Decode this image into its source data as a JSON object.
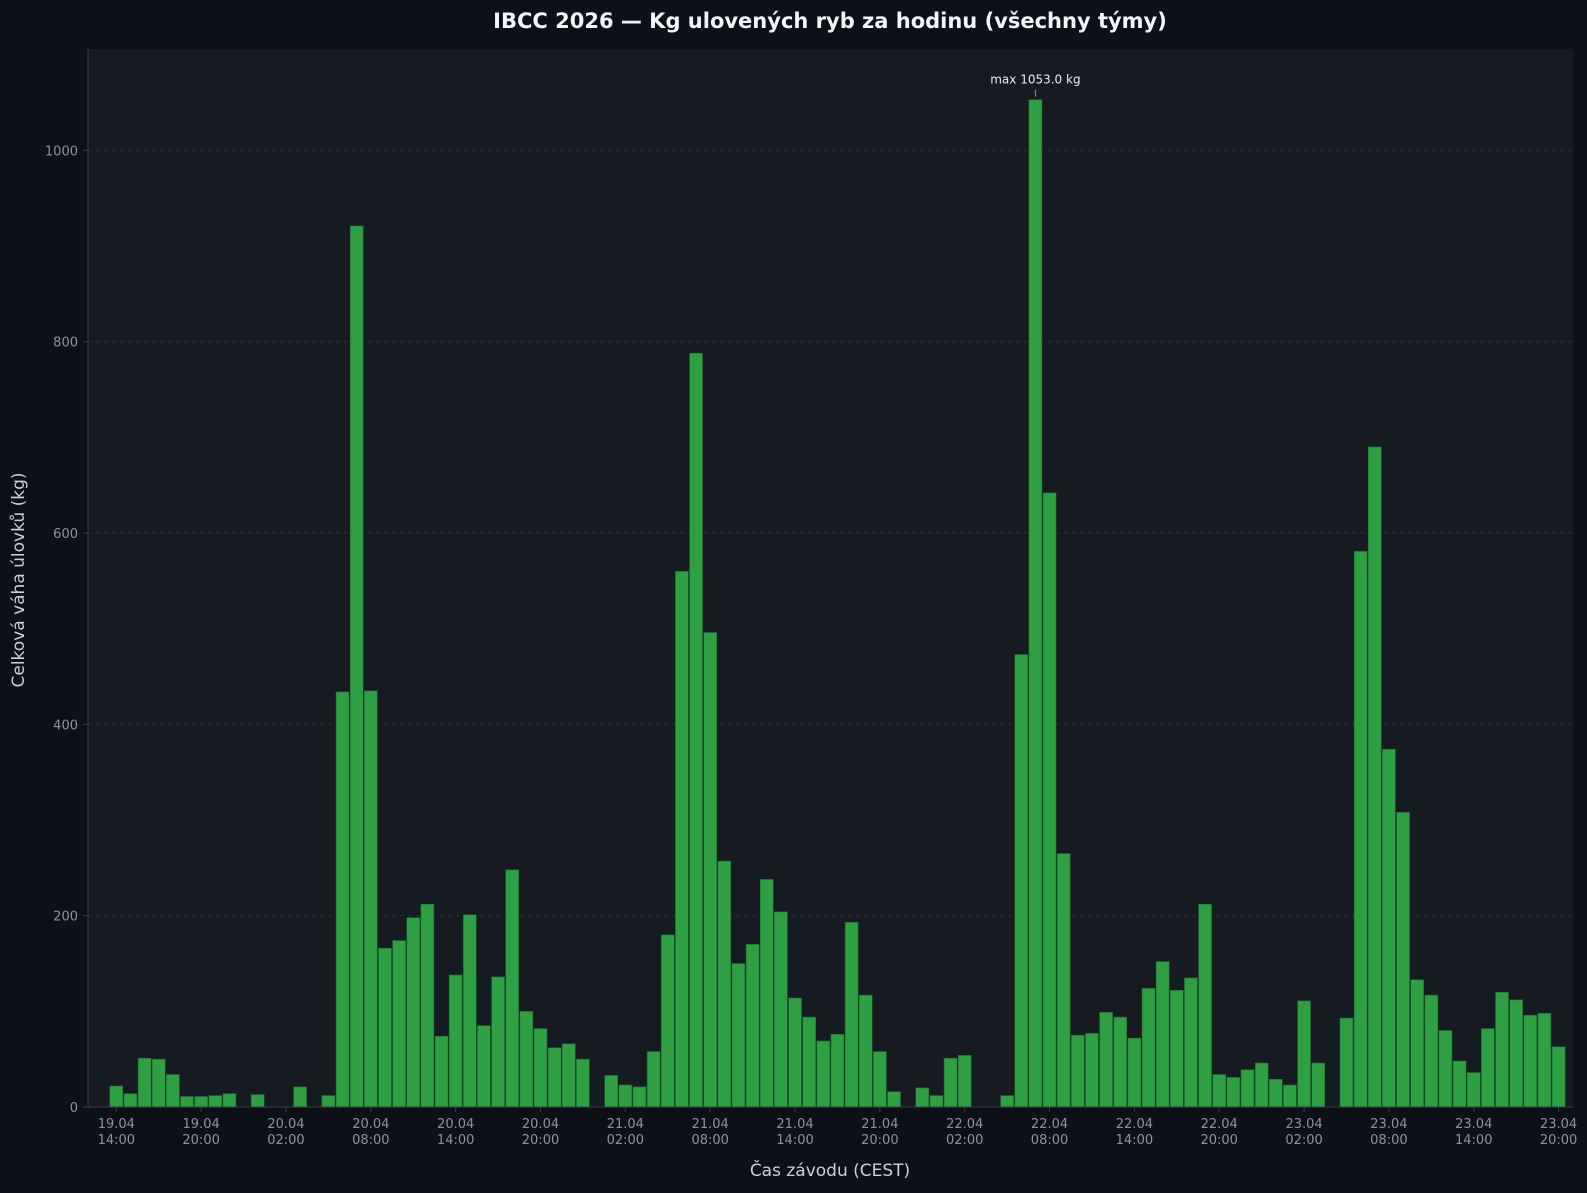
{
  "colors": {
    "page_background": "#0d1117",
    "plot_background": "#161b22",
    "bar_fill": "#2ea043",
    "bar_edge": "#1a6b2c",
    "grid": "#2a2f36",
    "axis": "#3a3f46",
    "tick_text": "#8b949e",
    "title_text": "#f0f6fc",
    "label_text": "#c9d1d9",
    "annotation_text": "#e6edf3"
  },
  "chart_data": {
    "type": "bar",
    "title": "IBCC 2026 — Kg ulovených ryb za hodinu (všechny týmy)",
    "xlabel": "Čas závodu (CEST)",
    "ylabel": "Celková váha úlovků (kg)",
    "ylim": [
      0,
      1106
    ],
    "y_ticks": [
      0,
      200,
      400,
      600,
      800,
      1000
    ],
    "grid": "horizontal, dashed",
    "x_start": "19.04 14:00",
    "x_step": "1 hour",
    "x_ticks": [
      {
        "date": "19.04",
        "time": "14:00"
      },
      {
        "date": "19.04",
        "time": "20:00"
      },
      {
        "date": "20.04",
        "time": "02:00"
      },
      {
        "date": "20.04",
        "time": "08:00"
      },
      {
        "date": "20.04",
        "time": "14:00"
      },
      {
        "date": "20.04",
        "time": "20:00"
      },
      {
        "date": "21.04",
        "time": "02:00"
      },
      {
        "date": "21.04",
        "time": "08:00"
      },
      {
        "date": "21.04",
        "time": "14:00"
      },
      {
        "date": "21.04",
        "time": "20:00"
      },
      {
        "date": "22.04",
        "time": "02:00"
      },
      {
        "date": "22.04",
        "time": "08:00"
      },
      {
        "date": "22.04",
        "time": "14:00"
      },
      {
        "date": "22.04",
        "time": "20:00"
      },
      {
        "date": "23.04",
        "time": "02:00"
      },
      {
        "date": "23.04",
        "time": "08:00"
      },
      {
        "date": "23.04",
        "time": "14:00"
      },
      {
        "date": "23.04",
        "time": "20:00"
      }
    ],
    "values": [
      22,
      14,
      51,
      50,
      34,
      11,
      11,
      12,
      14,
      0,
      13,
      0,
      0,
      21,
      0,
      12,
      434,
      921,
      435,
      166,
      174,
      198,
      212,
      74,
      138,
      201,
      85,
      136,
      248,
      100,
      82,
      62,
      66,
      50,
      0,
      33,
      23,
      21,
      58,
      180,
      560,
      788,
      496,
      257,
      150,
      170,
      238,
      204,
      114,
      94,
      69,
      76,
      193,
      117,
      58,
      16,
      0,
      20,
      12,
      51,
      54,
      0,
      0,
      12,
      473,
      1053,
      642,
      265,
      75,
      77,
      99,
      94,
      72,
      124,
      152,
      122,
      135,
      212,
      34,
      31,
      39,
      46,
      29,
      23,
      111,
      46,
      0,
      93,
      581,
      690,
      374,
      308,
      133,
      117,
      80,
      48,
      36,
      82,
      120,
      112,
      96,
      98,
      63
    ],
    "annotations": [
      {
        "text": "max 1053.0 kg",
        "index": 65,
        "value": 1053
      }
    ]
  }
}
